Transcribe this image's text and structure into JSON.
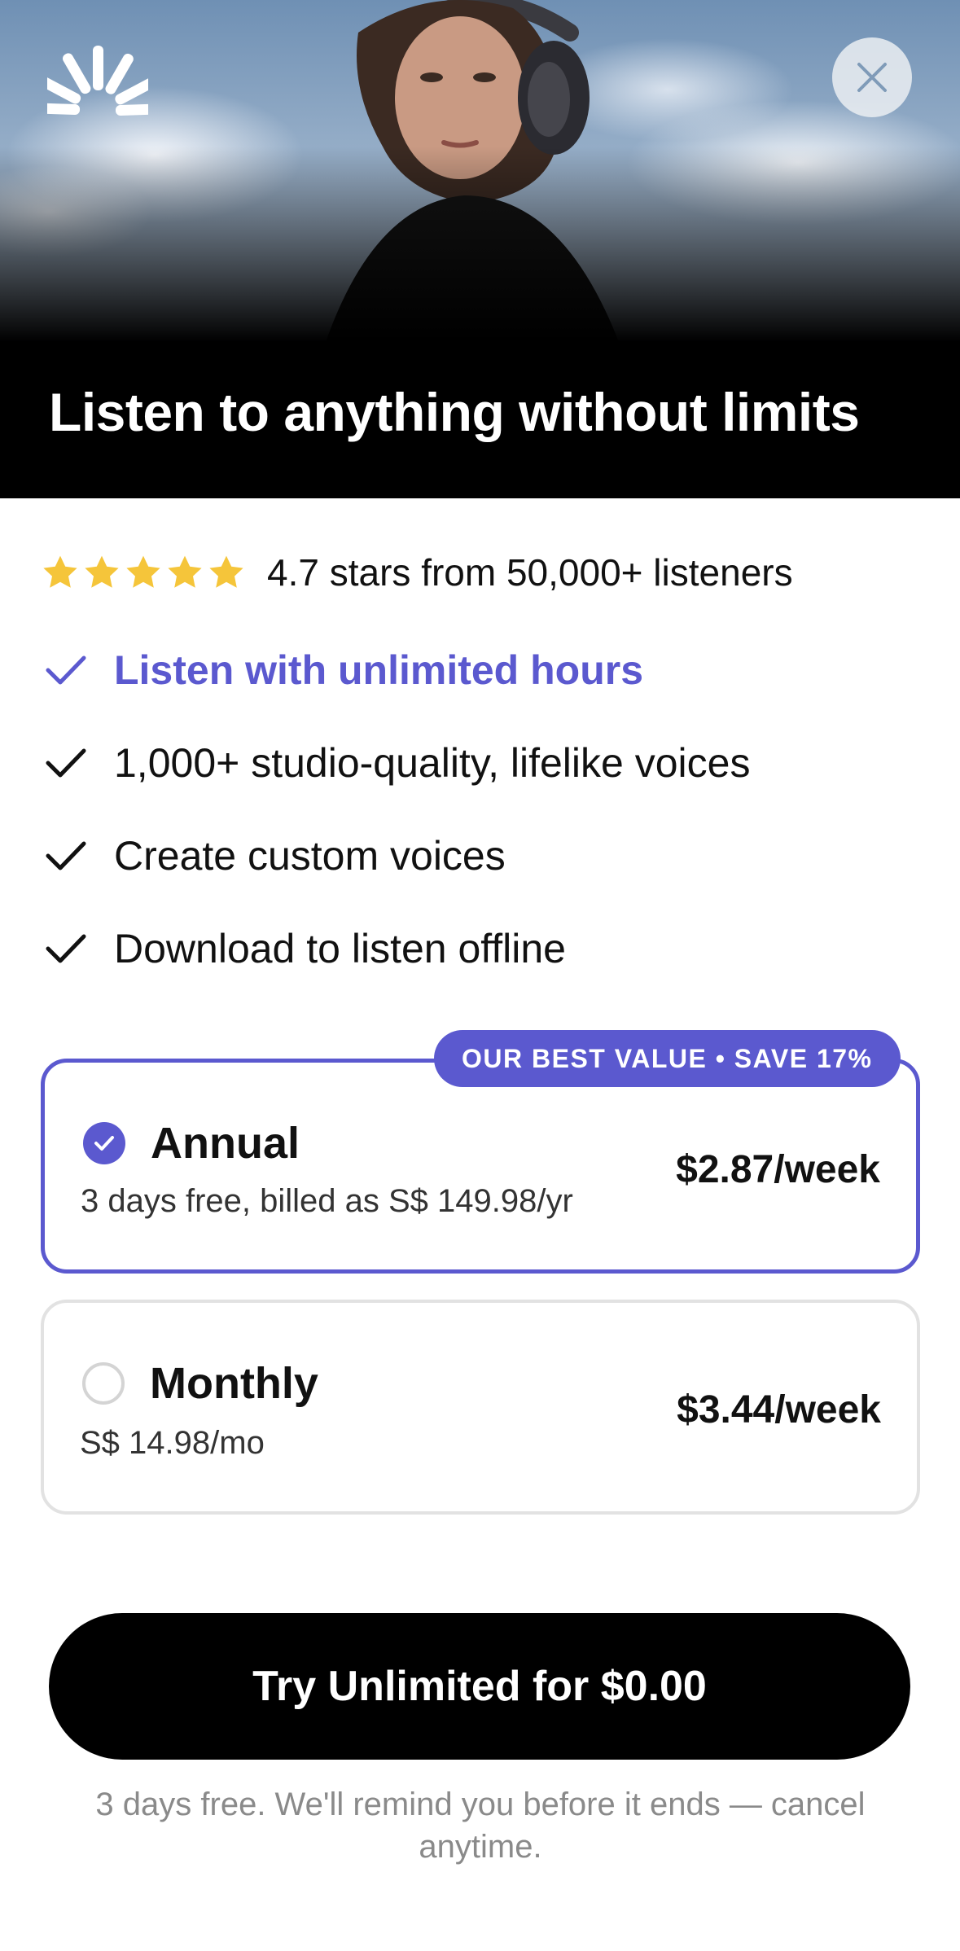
{
  "hero": {
    "title": "Listen to anything without limits",
    "logo_icon": "sunburst-logo-icon",
    "close_icon": "close-icon"
  },
  "rating": {
    "stars": 5,
    "star_color": "#f5c53a",
    "text": "4.7 stars from 50,000+ listeners"
  },
  "features": [
    {
      "text": "Listen with unlimited hours",
      "highlighted": true
    },
    {
      "text": "1,000+ studio-quality, lifelike voices",
      "highlighted": false
    },
    {
      "text": "Create custom voices",
      "highlighted": false
    },
    {
      "text": "Download to listen offline",
      "highlighted": false
    }
  ],
  "plans": {
    "badge": "OUR BEST VALUE • SAVE 17%",
    "annual": {
      "name": "Annual",
      "subtitle": "3 days free, billed as S$ 149.98/yr",
      "price": "$2.87/week",
      "selected": true
    },
    "monthly": {
      "name": "Monthly",
      "subtitle": "S$ 14.98/mo",
      "price": "$3.44/week",
      "selected": false
    }
  },
  "cta": {
    "label": "Try Unlimited for $0.00",
    "footnote": "3 days free. We'll remind you before it ends — cancel anytime."
  },
  "colors": {
    "accent": "#5b59cf",
    "cta_background": "#000000",
    "footnote": "#8a8a8a"
  }
}
